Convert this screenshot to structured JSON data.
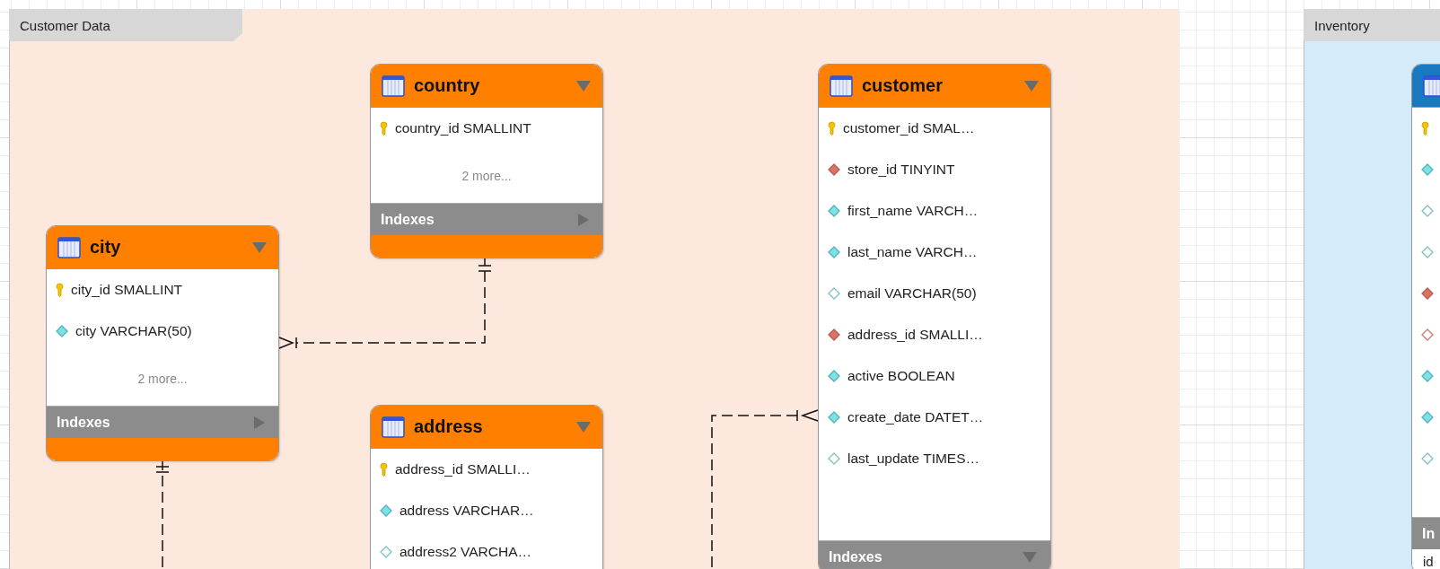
{
  "layers": [
    {
      "title": "Customer Data",
      "color": "#fde8de"
    },
    {
      "title": "Inventory",
      "color": "#d4ecfa"
    }
  ],
  "tables": [
    {
      "name": "country",
      "color": "#ff8000",
      "columns": [
        {
          "kind": "key",
          "text": "country_id SMALLINT"
        }
      ],
      "more": "2 more...",
      "indexes": {
        "label": "Indexes",
        "expanded": false
      }
    },
    {
      "name": "city",
      "color": "#ff8000",
      "columns": [
        {
          "kind": "key",
          "text": "city_id SMALLINT"
        },
        {
          "kind": "column",
          "text": "city VARCHAR(50)"
        }
      ],
      "more": "2 more...",
      "indexes": {
        "label": "Indexes",
        "expanded": false
      }
    },
    {
      "name": "address",
      "color": "#ff8000",
      "columns": [
        {
          "kind": "key",
          "text": "address_id SMALLI…"
        },
        {
          "kind": "column",
          "text": "address VARCHAR…"
        },
        {
          "kind": "nullable",
          "text": "address2 VARCHA…"
        }
      ]
    },
    {
      "name": "customer",
      "color": "#ff8000",
      "columns": [
        {
          "kind": "key",
          "text": "customer_id SMAL…"
        },
        {
          "kind": "fk",
          "text": "store_id TINYINT"
        },
        {
          "kind": "column",
          "text": "first_name VARCH…"
        },
        {
          "kind": "column",
          "text": "last_name VARCH…"
        },
        {
          "kind": "nullable",
          "text": "email VARCHAR(50)"
        },
        {
          "kind": "fk",
          "text": "address_id SMALLI…"
        },
        {
          "kind": "column",
          "text": "active BOOLEAN"
        },
        {
          "kind": "column",
          "text": "create_date DATET…"
        },
        {
          "kind": "nullable",
          "text": "last_update TIMES…"
        }
      ],
      "indexes": {
        "label": "Indexes",
        "expanded": true
      }
    },
    {
      "color": "#1878c0",
      "columns": [
        {
          "kind": "key"
        },
        {
          "kind": "column"
        },
        {
          "kind": "nullable"
        },
        {
          "kind": "nullable"
        },
        {
          "kind": "fk"
        },
        {
          "kind": "fk-nullable"
        },
        {
          "kind": "column"
        },
        {
          "kind": "column"
        },
        {
          "kind": "nullable"
        }
      ],
      "indexes": {
        "label": "In",
        "expanded": true,
        "items": [
          "id"
        ]
      }
    }
  ]
}
